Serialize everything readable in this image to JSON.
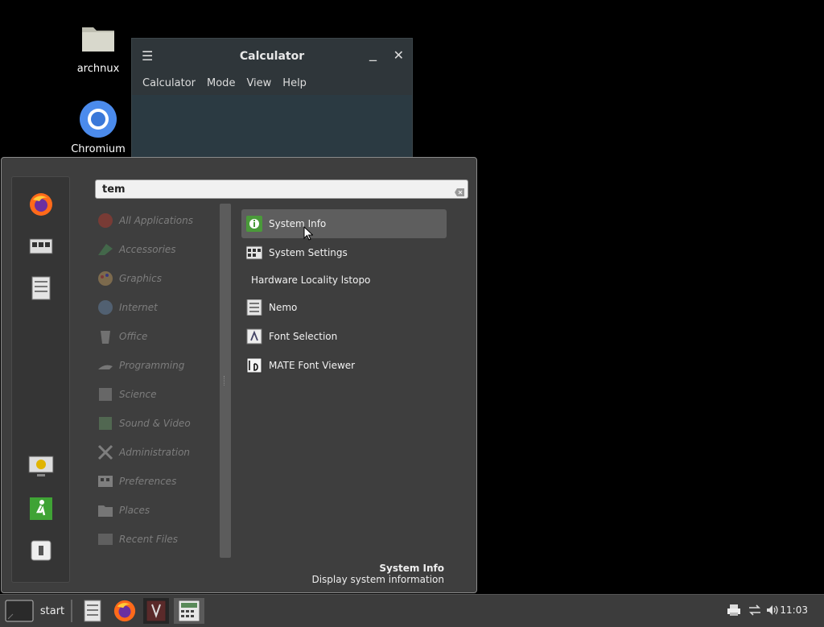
{
  "desktop": {
    "icons": [
      {
        "label": "archnux",
        "icon": "folder-icon"
      },
      {
        "label": "Chromium",
        "icon": "chromium-icon"
      }
    ]
  },
  "calculator": {
    "title": "Calculator",
    "menus": [
      "Calculator",
      "Mode",
      "View",
      "Help"
    ]
  },
  "menu": {
    "search_value": "tem",
    "favorites": [
      "firefox-icon",
      "software-manager-icon",
      "file-manager-icon",
      "lock-screen-icon",
      "logout-icon",
      "shutdown-icon"
    ],
    "categories": [
      {
        "label": "All Applications",
        "icon": "all-apps-icon"
      },
      {
        "label": "Accessories",
        "icon": "accessories-icon"
      },
      {
        "label": "Graphics",
        "icon": "graphics-icon"
      },
      {
        "label": "Internet",
        "icon": "internet-icon"
      },
      {
        "label": "Office",
        "icon": "office-icon"
      },
      {
        "label": "Programming",
        "icon": "programming-icon"
      },
      {
        "label": "Science",
        "icon": "science-icon"
      },
      {
        "label": "Sound & Video",
        "icon": "sound-video-icon"
      },
      {
        "label": "Administration",
        "icon": "administration-icon"
      },
      {
        "label": "Preferences",
        "icon": "preferences-icon"
      },
      {
        "label": "Places",
        "icon": "places-icon"
      },
      {
        "label": "Recent Files",
        "icon": "recent-files-icon"
      }
    ],
    "results": [
      {
        "label": "System Info",
        "icon": "system-info-icon",
        "selected": true
      },
      {
        "label": "System Settings",
        "icon": "system-settings-icon"
      },
      {
        "label": "Hardware Locality lstopo",
        "icon": ""
      },
      {
        "label": "Nemo",
        "icon": "nemo-icon"
      },
      {
        "label": "Font Selection",
        "icon": "font-selection-icon"
      },
      {
        "label": "MATE Font Viewer",
        "icon": "font-viewer-icon"
      }
    ],
    "description_title": "System Info",
    "description_text": "Display system information"
  },
  "taskbar": {
    "start_label": "start",
    "clock": "11:03"
  },
  "colors": {
    "menu_bg": "#3e3e3e",
    "selected_bg": "#5e5e5e",
    "taskbar_bg": "#3c3c3c",
    "calc_bg": "#2f3a40"
  }
}
